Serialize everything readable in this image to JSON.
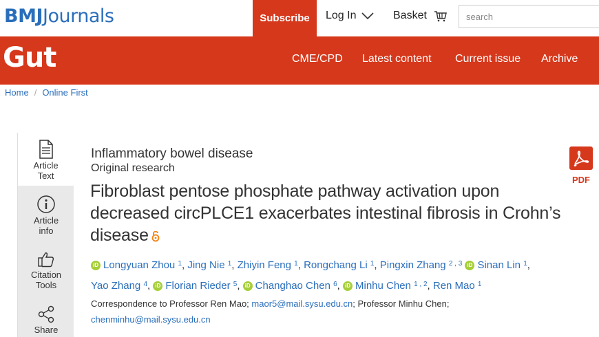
{
  "header": {
    "logo_bold": "BMJ",
    "logo_rest": "Journals",
    "subscribe": "Subscribe",
    "login": "Log In",
    "basket": "Basket",
    "search_placeholder": "search"
  },
  "nav": {
    "journal": "Gut",
    "links": [
      "CME/CPD",
      "Latest content",
      "Current issue",
      "Archive"
    ]
  },
  "breadcrumb": {
    "home": "Home",
    "sep": "/",
    "current": "Online First"
  },
  "tools": [
    {
      "label1": "Article",
      "label2": "Text",
      "icon": "document-icon"
    },
    {
      "label1": "Article",
      "label2": "info",
      "icon": "info-icon"
    },
    {
      "label1": "Citation",
      "label2": "Tools",
      "icon": "thumbs-up-icon"
    },
    {
      "label1": "Share",
      "label2": "",
      "icon": "share-icon"
    }
  ],
  "article": {
    "subject": "Inflammatory bowel disease",
    "type": "Original research",
    "title": "Fibroblast pentose phosphate pathway activation upon decreased circPLCE1 exacerbates intestinal fibrosis in Crohn’s disease",
    "pdf_label": "PDF",
    "authors": [
      {
        "name": "Longyuan Zhou",
        "aff": "1",
        "orcid": true
      },
      {
        "name": "Jing Nie",
        "aff": "1",
        "orcid": false
      },
      {
        "name": "Zhiyin Feng",
        "aff": "1",
        "orcid": false
      },
      {
        "name": "Rongchang Li",
        "aff": "1",
        "orcid": false
      },
      {
        "name": "Pingxin Zhang",
        "aff": "2 , 3",
        "orcid": false
      },
      {
        "name": "Sinan Lin",
        "aff": "1",
        "orcid": true
      },
      {
        "name": "Yao Zhang",
        "aff": "4",
        "orcid": false
      },
      {
        "name": "Florian Rieder",
        "aff": "5",
        "orcid": true
      },
      {
        "name": "Changhao Chen",
        "aff": "6",
        "orcid": true
      },
      {
        "name": "Minhu Chen",
        "aff": "1 , 2",
        "orcid": true
      },
      {
        "name": "Ren Mao",
        "aff": "1",
        "orcid": false
      }
    ],
    "correspondence": {
      "prefix": "Correspondence to Professor Ren Mao; ",
      "email1": "maor5@mail.sysu.edu.cn",
      "middle": "; Professor Minhu Chen;",
      "email2": "chenminhu@mail.sysu.edu.cn"
    }
  },
  "colors": {
    "brand_red": "#d6381c",
    "link_blue": "#2a6ebb",
    "orcid_green": "#a6ce39"
  }
}
